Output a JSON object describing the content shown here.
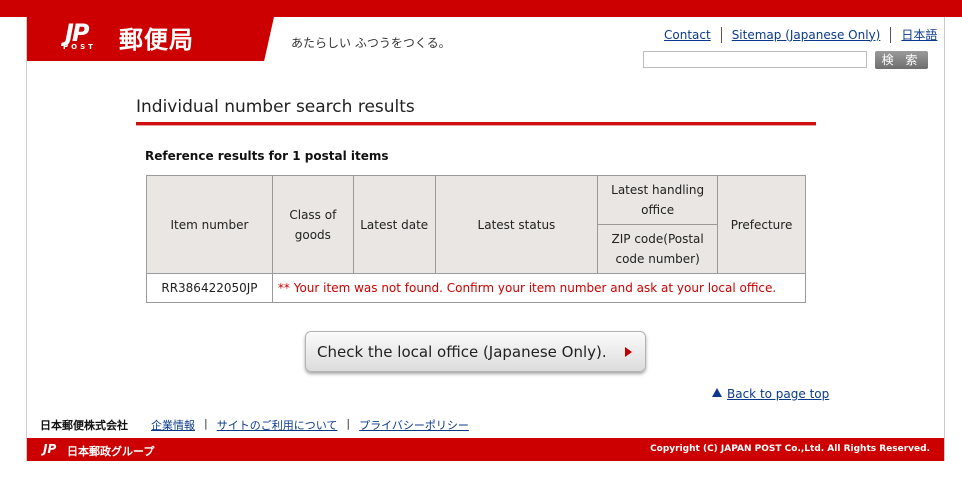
{
  "header": {
    "logo_mark": "JP",
    "logo_post": "POST",
    "logo_text": "郵便局",
    "tagline": "あたらしい ふつうをつくる。",
    "links": [
      "Contact",
      "Sitemap (Japanese Only)",
      "日本語"
    ],
    "search": {
      "value": "",
      "button_label": "検 索"
    }
  },
  "page": {
    "heading": "Individual number search results",
    "reference_text": "Reference results for 1 postal items"
  },
  "table": {
    "headers": {
      "item_number": "Item number",
      "class_of_goods": "Class of goods",
      "latest_date": "Latest date",
      "latest_status": "Latest status",
      "latest_handling_office": "Latest handling office",
      "zip_code": "ZIP code(Postal code number)",
      "prefecture": "Prefecture"
    },
    "rows": [
      {
        "item_number": "RR386422050JP",
        "message": "** Your item was not found. Confirm your item number and ask at your local office."
      }
    ]
  },
  "actions": {
    "check_local_office": "Check the local office (Japanese Only).",
    "back_to_top": "Back to page top"
  },
  "footer": {
    "company": "日本郵便株式会社",
    "links": [
      "企業情報",
      "サイトのご利用について",
      "プライバシーポリシー"
    ],
    "group_mark": "JP",
    "group": "日本郵政グループ",
    "copyright": "Copyright (C) JAPAN POST Co.,Ltd.  All Rights Reserved."
  },
  "colors": {
    "brand_red": "#cc0000",
    "link_blue": "#0b3a8a",
    "table_header_bg": "#e9e6e3"
  }
}
